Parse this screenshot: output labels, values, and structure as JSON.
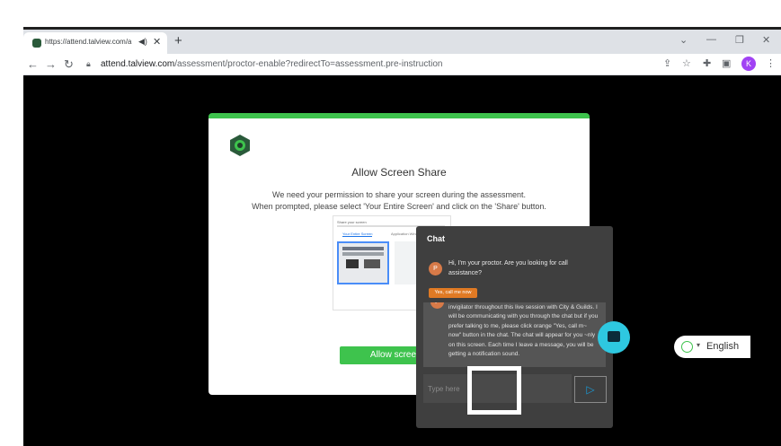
{
  "browser": {
    "tab_title": "https://attend.talview.com/a",
    "url_host": "attend.talview.com",
    "url_path": "/assessment/proctor-enable?redirectTo=assessment.pre-instruction"
  },
  "card": {
    "title": "Allow Screen Share",
    "message_line1": "We need your permission to share your screen during the assessment.",
    "message_line2": "When prompted, please select 'Your Entire Screen' and click on the 'Share' button.",
    "share_button": "Allow screen S",
    "preview": {
      "title": "Share your screen",
      "tab_entire": "Your Entire Screen",
      "tab_window": "Application Window"
    }
  },
  "chat": {
    "header": "Chat",
    "proctor_initial": "P",
    "message1": "Hi, I'm your proctor. Are you looking for call assistance?",
    "quick_reply": "Yes, call me now",
    "message2": "invigilator throughout this live session with City & Guilds. I will be communicating with you through the chat but if you prefer talking to me, please click orange \"Yes, call m~ now\" button in the chat. The chat will appear for you ~nly on this screen. Each time I leave a message, you will be getting a notification sound.",
    "input_placeholder": "Type here"
  },
  "language": {
    "label": "English"
  },
  "user": {
    "avatar_initial": "K"
  },
  "colors": {
    "accent_green": "#3ec34d",
    "orange": "#e07a24",
    "chat_fab": "#2ec8e0",
    "send_icon": "#1a9bd7"
  }
}
